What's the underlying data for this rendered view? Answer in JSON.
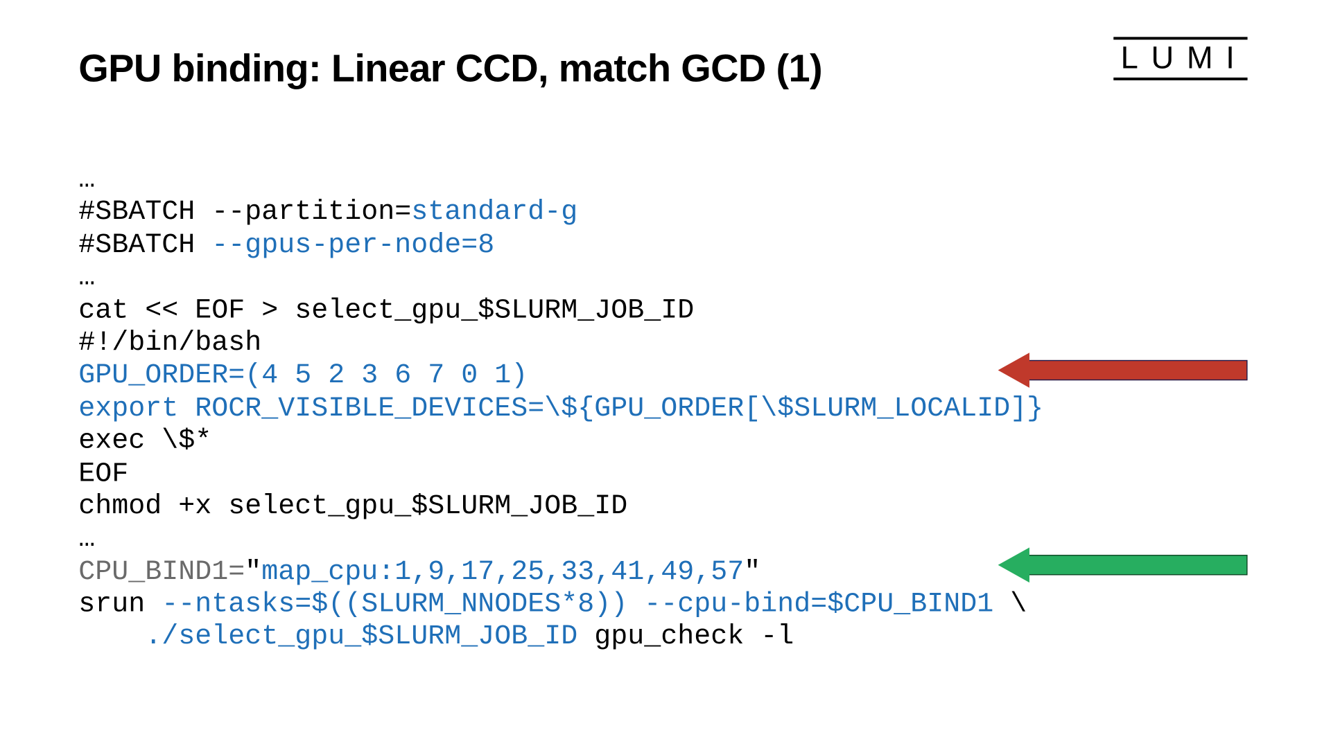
{
  "title": "GPU binding: Linear CCD, match GCD (1)",
  "logo": "LUMI",
  "code": {
    "l1": "…",
    "l2a": "#SBATCH --partition=",
    "l2b": "standard-g",
    "l3a": "#SBATCH ",
    "l3b": "--gpus-per-node=8",
    "l4": "…",
    "l5": "cat << EOF > select_gpu_$SLURM_JOB_ID",
    "l6": "#!/bin/bash",
    "l7": "GPU_ORDER=(4 5 2 3 6 7 0 1)",
    "l8": "export ROCR_VISIBLE_DEVICES=\\${GPU_ORDER[\\$SLURM_LOCALID]}",
    "l9": "exec \\$*",
    "l10": "EOF",
    "l11": "chmod +x select_gpu_$SLURM_JOB_ID",
    "l12": "…",
    "l13a": "CPU_BIND1=",
    "l13b": "\"",
    "l13c": "map_cpu:1,9,17,25,33,41,49,57",
    "l13d": "\"",
    "l14a": "srun ",
    "l14b": "--ntasks=$((SLURM_NNODES*8)) --cpu-bind=$CPU_BIND1 ",
    "l14c": "\\",
    "l15a": "    ",
    "l15b": "./select_gpu_$SLURM_JOB_ID ",
    "l15c": "gpu_check -l"
  }
}
